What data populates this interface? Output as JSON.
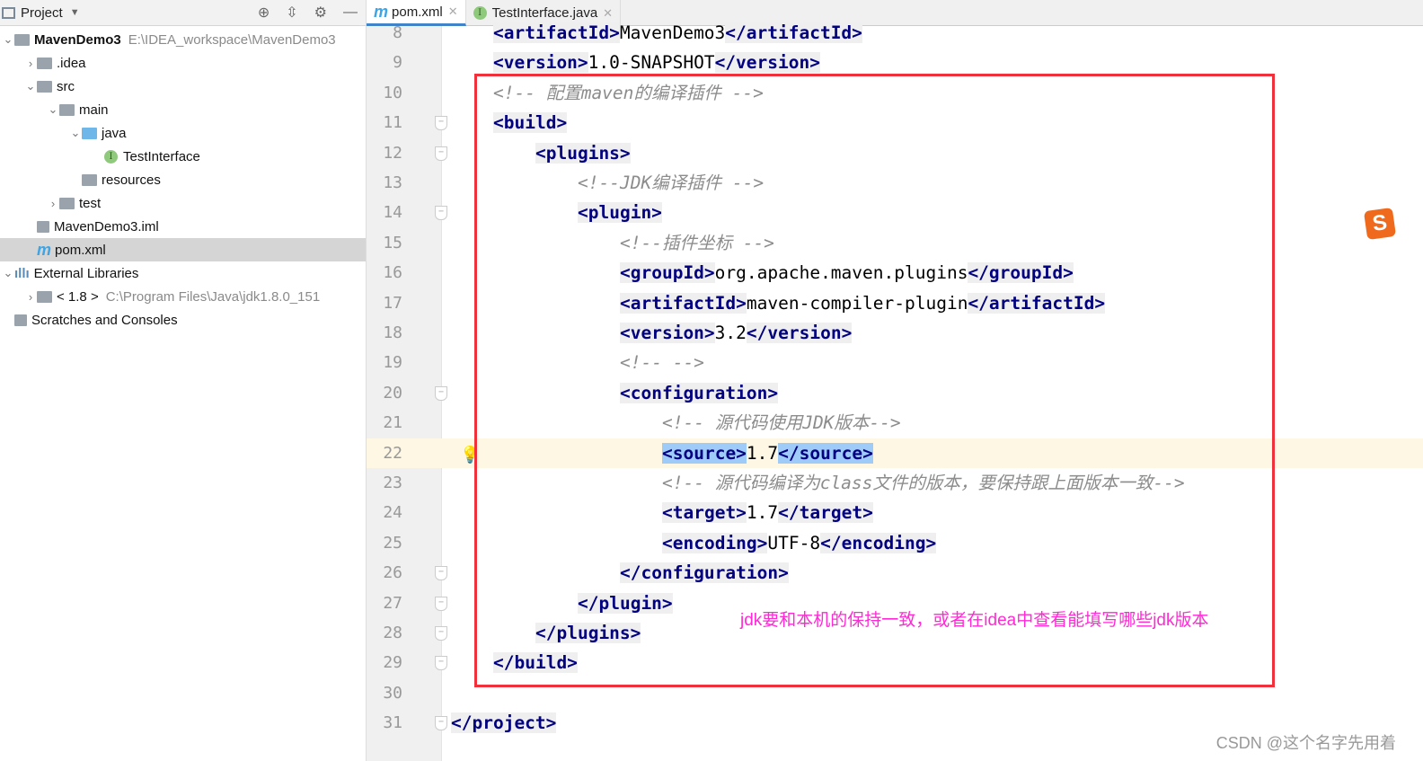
{
  "sidebar": {
    "title": "Project",
    "tree": [
      {
        "label": "MavenDemo3",
        "hint": "E:\\IDEA_workspace\\MavenDemo3",
        "level": 0,
        "expanded": true,
        "bold": true,
        "icon": "module-folder-icon"
      },
      {
        "label": ".idea",
        "level": 1,
        "expanded": false,
        "icon": "folder-icon"
      },
      {
        "label": "src",
        "level": 1,
        "expanded": true,
        "icon": "folder-icon"
      },
      {
        "label": "main",
        "level": 2,
        "expanded": true,
        "icon": "folder-icon"
      },
      {
        "label": "java",
        "level": 3,
        "expanded": true,
        "icon": "source-folder-icon"
      },
      {
        "label": "TestInterface",
        "level": 4,
        "icon": "interface-icon"
      },
      {
        "label": "resources",
        "level": 3,
        "icon": "resources-folder-icon"
      },
      {
        "label": "test",
        "level": 2,
        "expanded": false,
        "icon": "folder-icon"
      },
      {
        "label": "MavenDemo3.iml",
        "level": 1,
        "icon": "iml-file-icon"
      },
      {
        "label": "pom.xml",
        "level": 1,
        "icon": "maven-icon",
        "selected": true
      },
      {
        "label": "External Libraries",
        "level": 0,
        "expanded": true,
        "icon": "libraries-icon"
      },
      {
        "label": "< 1.8 >",
        "hint": "C:\\Program Files\\Java\\jdk1.8.0_151",
        "level": 1,
        "expanded": false,
        "icon": "jdk-icon"
      },
      {
        "label": "Scratches and Consoles",
        "level": 0,
        "icon": "scratches-icon"
      }
    ]
  },
  "tabs": [
    {
      "label": "pom.xml",
      "active": true
    },
    {
      "label": "TestInterface.java",
      "active": false
    }
  ],
  "editor": {
    "lines": [
      {
        "n": "8",
        "indent": 1,
        "tokens": [
          [
            "tag",
            "<artifactId>"
          ],
          [
            "txt",
            "MavenDemo3"
          ],
          [
            "tag",
            "</artifactId>"
          ]
        ]
      },
      {
        "n": "9",
        "indent": 1,
        "tokens": [
          [
            "tag",
            "<version>"
          ],
          [
            "txt",
            "1.0-SNAPSHOT"
          ],
          [
            "tag",
            "</version>"
          ]
        ]
      },
      {
        "n": "10",
        "indent": 1,
        "tokens": [
          [
            "cm",
            "<!-- 配置maven的编译插件 -->"
          ]
        ]
      },
      {
        "n": "11",
        "indent": 1,
        "fold": true,
        "tokens": [
          [
            "tag",
            "<build>"
          ]
        ]
      },
      {
        "n": "12",
        "indent": 2,
        "fold": true,
        "tokens": [
          [
            "tag",
            "<plugins>"
          ]
        ]
      },
      {
        "n": "13",
        "indent": 3,
        "tokens": [
          [
            "cm",
            "<!--JDK编译插件 -->"
          ]
        ]
      },
      {
        "n": "14",
        "indent": 3,
        "fold": true,
        "tokens": [
          [
            "tag",
            "<plugin>"
          ]
        ]
      },
      {
        "n": "15",
        "indent": 4,
        "tokens": [
          [
            "cm",
            "<!--插件坐标 -->"
          ]
        ]
      },
      {
        "n": "16",
        "indent": 4,
        "tokens": [
          [
            "tag",
            "<groupId>"
          ],
          [
            "txt",
            "org.apache.maven.plugins"
          ],
          [
            "tag",
            "</groupId>"
          ]
        ]
      },
      {
        "n": "17",
        "indent": 4,
        "tokens": [
          [
            "tag",
            "<artifactId>"
          ],
          [
            "txt",
            "maven-compiler-plugin"
          ],
          [
            "tag",
            "</artifactId>"
          ]
        ]
      },
      {
        "n": "18",
        "indent": 4,
        "tokens": [
          [
            "tag",
            "<version>"
          ],
          [
            "txt",
            "3.2"
          ],
          [
            "tag",
            "</version>"
          ]
        ]
      },
      {
        "n": "19",
        "indent": 4,
        "tokens": [
          [
            "cm",
            "<!-- -->"
          ]
        ]
      },
      {
        "n": "20",
        "indent": 4,
        "fold": true,
        "tokens": [
          [
            "tag",
            "<configuration>"
          ]
        ]
      },
      {
        "n": "21",
        "indent": 5,
        "tokens": [
          [
            "cm",
            "<!-- 源代码使用JDK版本-->"
          ]
        ]
      },
      {
        "n": "22",
        "indent": 5,
        "current": true,
        "bulb": true,
        "tokens": [
          [
            "tag sel",
            "<source>"
          ],
          [
            "txt",
            "1.7"
          ],
          [
            "tag sel",
            "</source>"
          ]
        ]
      },
      {
        "n": "23",
        "indent": 5,
        "tokens": [
          [
            "cm",
            "<!-- 源代码编译为class文件的版本，要保持跟上面版本一致-->"
          ]
        ]
      },
      {
        "n": "24",
        "indent": 5,
        "tokens": [
          [
            "tag",
            "<target>"
          ],
          [
            "txt",
            "1.7"
          ],
          [
            "tag",
            "</target>"
          ]
        ]
      },
      {
        "n": "25",
        "indent": 5,
        "tokens": [
          [
            "tag",
            "<encoding>"
          ],
          [
            "txt",
            "UTF-8"
          ],
          [
            "tag",
            "</encoding>"
          ]
        ]
      },
      {
        "n": "26",
        "indent": 4,
        "fold": true,
        "tokens": [
          [
            "tag",
            "</configuration>"
          ]
        ]
      },
      {
        "n": "27",
        "indent": 3,
        "fold": true,
        "tokens": [
          [
            "tag",
            "</plugin>"
          ]
        ]
      },
      {
        "n": "28",
        "indent": 2,
        "fold": true,
        "tokens": [
          [
            "tag",
            "</plugins>"
          ]
        ]
      },
      {
        "n": "29",
        "indent": 1,
        "fold": true,
        "tokens": [
          [
            "tag",
            "</build>"
          ]
        ]
      },
      {
        "n": "30",
        "indent": 0,
        "tokens": []
      },
      {
        "n": "31",
        "indent": 0,
        "fold": true,
        "tokens": [
          [
            "tag",
            "</project>"
          ]
        ]
      }
    ],
    "annotation": "jdk要和本机的保持一致，或者在idea中查看能填写哪些jdk版本",
    "highlight_color": "#f0303a"
  },
  "watermark": "CSDN @这个名字先用着"
}
